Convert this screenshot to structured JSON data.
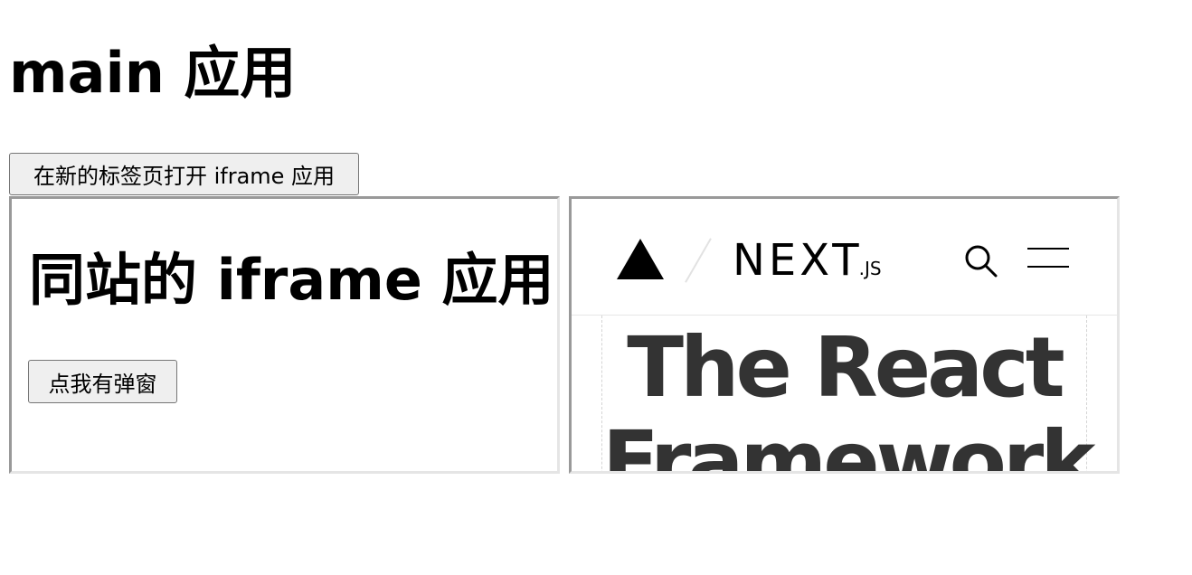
{
  "main": {
    "title": "main 应用",
    "open_tab_button": "在新的标签页打开 iframe 应用"
  },
  "iframe_same_site": {
    "title": "同站的 iframe 应用",
    "popup_button": "点我有弹窗"
  },
  "iframe_nextjs": {
    "logo_word": "NEXT",
    "logo_suffix": ".JS",
    "hero_lines": [
      "The React",
      "Framework"
    ],
    "icons": [
      "vercel-triangle-icon",
      "search-icon",
      "menu-icon"
    ]
  }
}
